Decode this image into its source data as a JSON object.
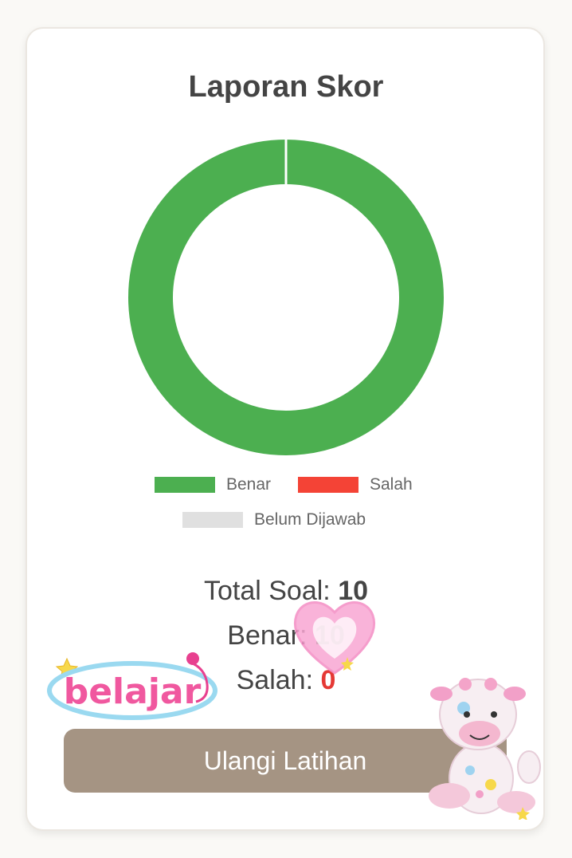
{
  "report": {
    "title": "Laporan Skor",
    "stats": {
      "total_label": "Total Soal:",
      "total_value": "10",
      "correct_label": "Benar:",
      "correct_value": "10",
      "wrong_label": "Salah:",
      "wrong_value": "0"
    },
    "retry_button_label": "Ulangi Latihan"
  },
  "chart_data": {
    "type": "pie",
    "labels": [
      "Benar",
      "Salah",
      "Belum Dijawab"
    ],
    "values": [
      10,
      0,
      0
    ],
    "colors": [
      "#4caf50",
      "#f44336",
      "#e0e0e0"
    ]
  },
  "stickers": {
    "belajar_text": "belajar",
    "plush_icon": "cow-plush-icon",
    "heart_icon": "heart-sticker-icon"
  },
  "colors": {
    "accent_button": "#a59483",
    "correct": "#2e9b46",
    "wrong": "#e53935"
  }
}
